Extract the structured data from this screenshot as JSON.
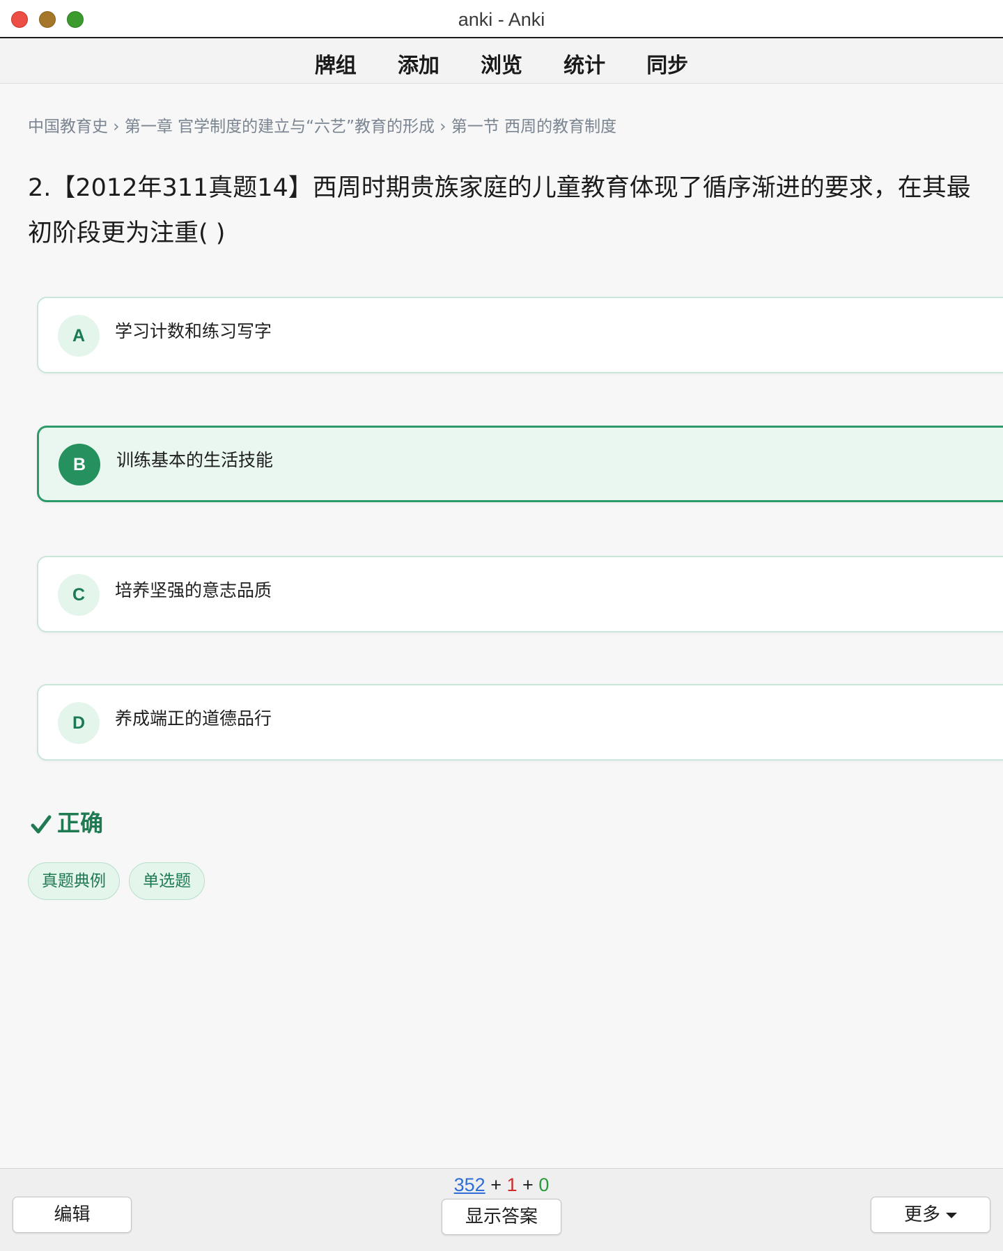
{
  "window": {
    "title": "anki - Anki"
  },
  "toolbar": {
    "items": [
      "牌组",
      "添加",
      "浏览",
      "统计",
      "同步"
    ]
  },
  "card": {
    "breadcrumb": "中国教育史 › 第一章 官学制度的建立与“六艺”教育的形成 › 第一节 西周的教育制度",
    "question": "2.【2012年311真题14】西周时期贵族家庭的儿童教育体现了循序渐进的要求，在其最初阶段更为注重( )",
    "options": [
      {
        "letter": "A",
        "text": "学习计数和练习写字",
        "selected": false
      },
      {
        "letter": "B",
        "text": "训练基本的生活技能",
        "selected": true
      },
      {
        "letter": "C",
        "text": "培养坚强的意志品质",
        "selected": false
      },
      {
        "letter": "D",
        "text": "养成端正的道德品行",
        "selected": false
      }
    ],
    "result": {
      "icon": "checkmark-icon",
      "label": "正确",
      "color": "#1f7a52"
    },
    "tags": [
      "真题典例",
      "单选题"
    ]
  },
  "bottombar": {
    "counts": {
      "new": "352",
      "learn": "1",
      "review": "0",
      "sep": "+"
    },
    "edit_label": "编辑",
    "show_answer_label": "显示答案",
    "more_label": "更多"
  },
  "colors": {
    "accent": "#2d9a6b",
    "new_count": "#2f6ed6",
    "learn_count": "#cc2b2b",
    "review_count": "#2a9b3c"
  }
}
